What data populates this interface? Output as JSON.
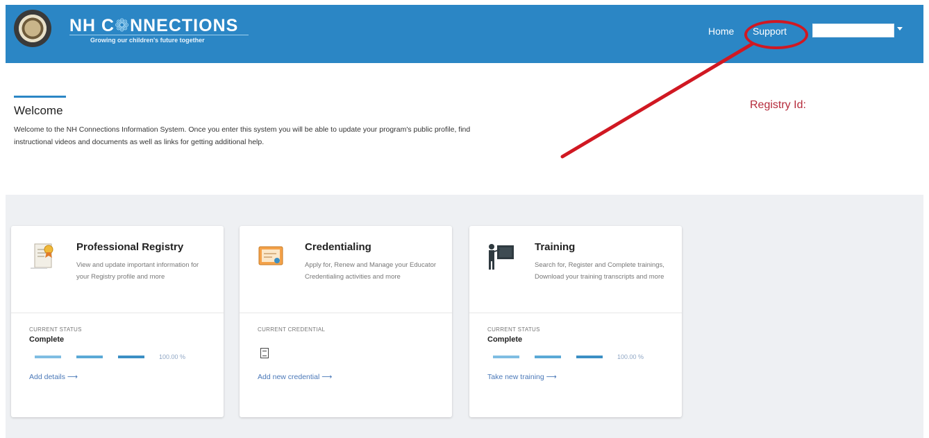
{
  "header": {
    "brand_title_before": "NH C",
    "brand_title_leaf": "❁",
    "brand_title_after": "NNECTIONS",
    "brand_tagline": "Growing our children's future together",
    "nav": {
      "home": "Home",
      "support": "Support"
    }
  },
  "welcome": {
    "title": "Welcome",
    "text": "Welcome to the NH Connections Information System. Once you enter this system you will be able to update your program's public profile, find instructional videos and documents as well as links for getting additional help.",
    "registry_id_label": "Registry Id:"
  },
  "cards": [
    {
      "title": "Professional Registry",
      "description": "View and update important information for your Registry profile and more",
      "status_label": "CURRENT STATUS",
      "status_value": "Complete",
      "progress": 1.0,
      "progress_text": "100.00 %",
      "link": "Add details ⟶"
    },
    {
      "title": "Credentialing",
      "description": "Apply for, Renew and Manage your Educator Credentialing activities and more",
      "status_label": "CURRENT CREDENTIAL",
      "link": "Add new credential ⟶"
    },
    {
      "title": "Training",
      "description": "Search for, Register and Complete trainings, Download your training transcripts and more",
      "status_label": "CURRENT STATUS",
      "status_value": "Complete",
      "progress": 1.0,
      "progress_text": "100.00 %",
      "link": "Take new training ⟶"
    }
  ],
  "colors": {
    "header_blue": "#2b86c5",
    "annotation_red": "#d01822",
    "registry_id_red": "#b52a3a",
    "link_blue": "#4a78b8"
  },
  "icons": [
    "state-seal-icon",
    "certificate-icon",
    "credential-card-icon",
    "teacher-board-icon",
    "document-icon",
    "caret-down-icon"
  ]
}
